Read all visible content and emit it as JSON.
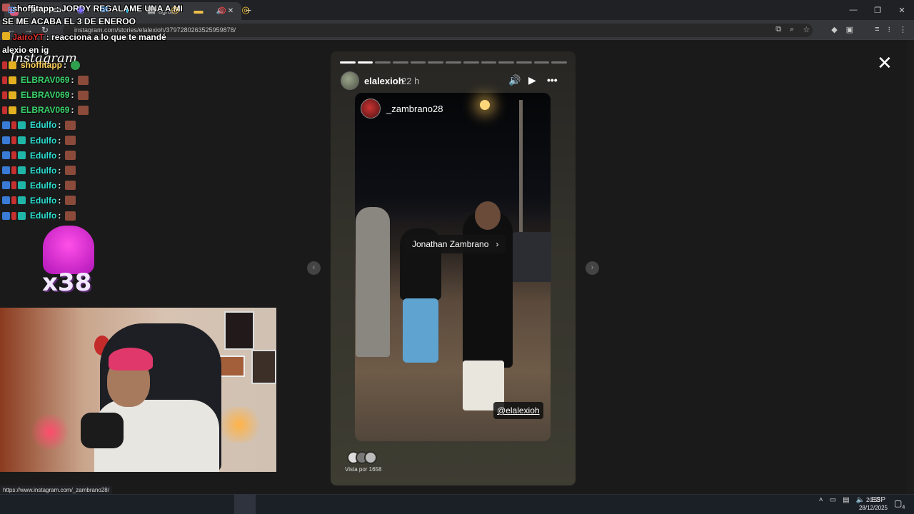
{
  "browser": {
    "tab_title": "shoffitapp : JORDY REGALAME UNA A MI... | Instagram",
    "tab_title_visible": "agram",
    "url": "instagram.com/stories/elalexioh/3797280263525959878/",
    "status_url": "https://www.instagram.com/_zambrano28/"
  },
  "overlay": {
    "donation_line1": "shoffitapp : JORDY REGALAME UNA A MI",
    "donation_line2": "SE ME ACABA EL 3 DE ENEROO",
    "reaction_line_user": "JairoYT",
    "reaction_line_text": ": reacciona a lo que te mandé",
    "context_line": "alexio en ig",
    "instagram_logo": "Instagram",
    "combo": "x38"
  },
  "chat": [
    {
      "user": "shoffitapp",
      "color": "#ffd35a",
      "badges": [
        "red",
        "gold"
      ],
      "emote": "green"
    },
    {
      "user": "ELBRAV069",
      "color": "#39d36b",
      "badges": [
        "red",
        "gold"
      ],
      "emote": "brown"
    },
    {
      "user": "ELBRAV069",
      "color": "#39d36b",
      "badges": [
        "red",
        "gold"
      ],
      "emote": "brown"
    },
    {
      "user": "ELBRAV069",
      "color": "#39d36b",
      "badges": [
        "red",
        "gold"
      ],
      "emote": "brown"
    },
    {
      "user": "Edulfo",
      "color": "#2ee0d2",
      "badges": [
        "blue",
        "red",
        "teal"
      ],
      "emote": "brown"
    },
    {
      "user": "Edulfo",
      "color": "#2ee0d2",
      "badges": [
        "blue",
        "red",
        "teal"
      ],
      "emote": "brown"
    },
    {
      "user": "Edulfo",
      "color": "#2ee0d2",
      "badges": [
        "blue",
        "red",
        "teal"
      ],
      "emote": "brown"
    },
    {
      "user": "Edulfo",
      "color": "#2ee0d2",
      "badges": [
        "blue",
        "red",
        "teal"
      ],
      "emote": "brown"
    },
    {
      "user": "Edulfo",
      "color": "#2ee0d2",
      "badges": [
        "blue",
        "red",
        "teal"
      ],
      "emote": "brown"
    },
    {
      "user": "Edulfo",
      "color": "#2ee0d2",
      "badges": [
        "blue",
        "red",
        "teal"
      ],
      "emote": "brown"
    },
    {
      "user": "Edulfo",
      "color": "#2ee0d2",
      "badges": [
        "blue",
        "red",
        "teal"
      ],
      "emote": "brown"
    }
  ],
  "story": {
    "username": "elalexioh",
    "time": "22 h",
    "shared_username": "_zambrano28",
    "mention_name": "Jonathan Zambrano",
    "handle_tag": "@elalexioh",
    "views": "Vista por 1658",
    "progress_segments": 13,
    "progress_done": 2
  },
  "taskbar": {
    "language": "ESP",
    "time": "20:53",
    "date": "28/12/2025",
    "notifications": "4"
  },
  "icons": {
    "mute": "speaker-icon",
    "play": "play-icon",
    "more": "more-icon",
    "close": "close-icon"
  }
}
